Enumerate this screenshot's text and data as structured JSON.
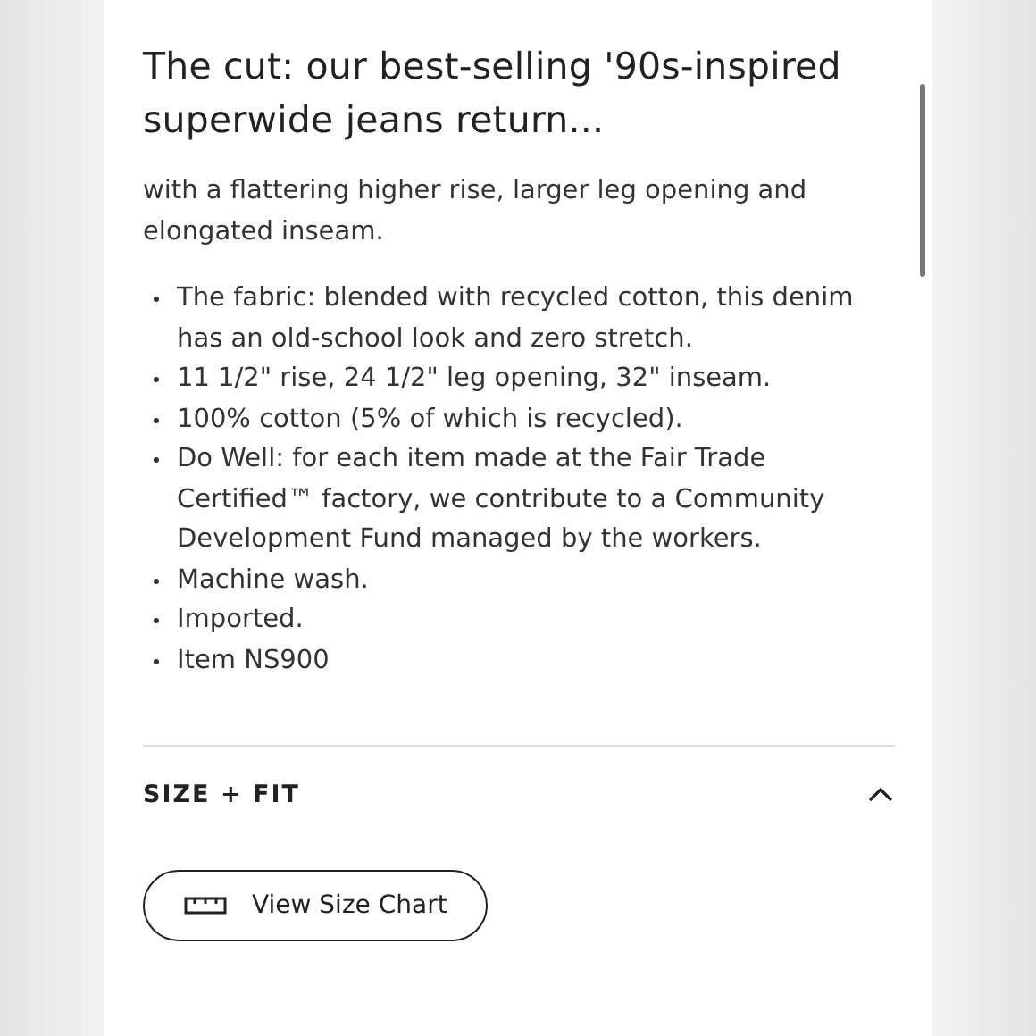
{
  "heading": "The cut: our best-selling '90s-inspired superwide jeans return...",
  "intro": "with a flattering higher rise, larger leg opening and elongated inseam.",
  "bullets": [
    "The fabric: blended with recycled cotton, this denim has an old-school look and zero stretch.",
    "11 1/2\" rise, 24 1/2\" leg opening, 32\" inseam.",
    "100% cotton (5% of which is recycled).",
    "Do Well: for each item made at the Fair Trade Certified™ factory, we contribute to a Community Development Fund managed by the workers.",
    "Machine wash.",
    "Imported.",
    "Item NS900"
  ],
  "section": {
    "title": "SIZE + FIT",
    "expanded": true,
    "button": "View Size Chart"
  }
}
